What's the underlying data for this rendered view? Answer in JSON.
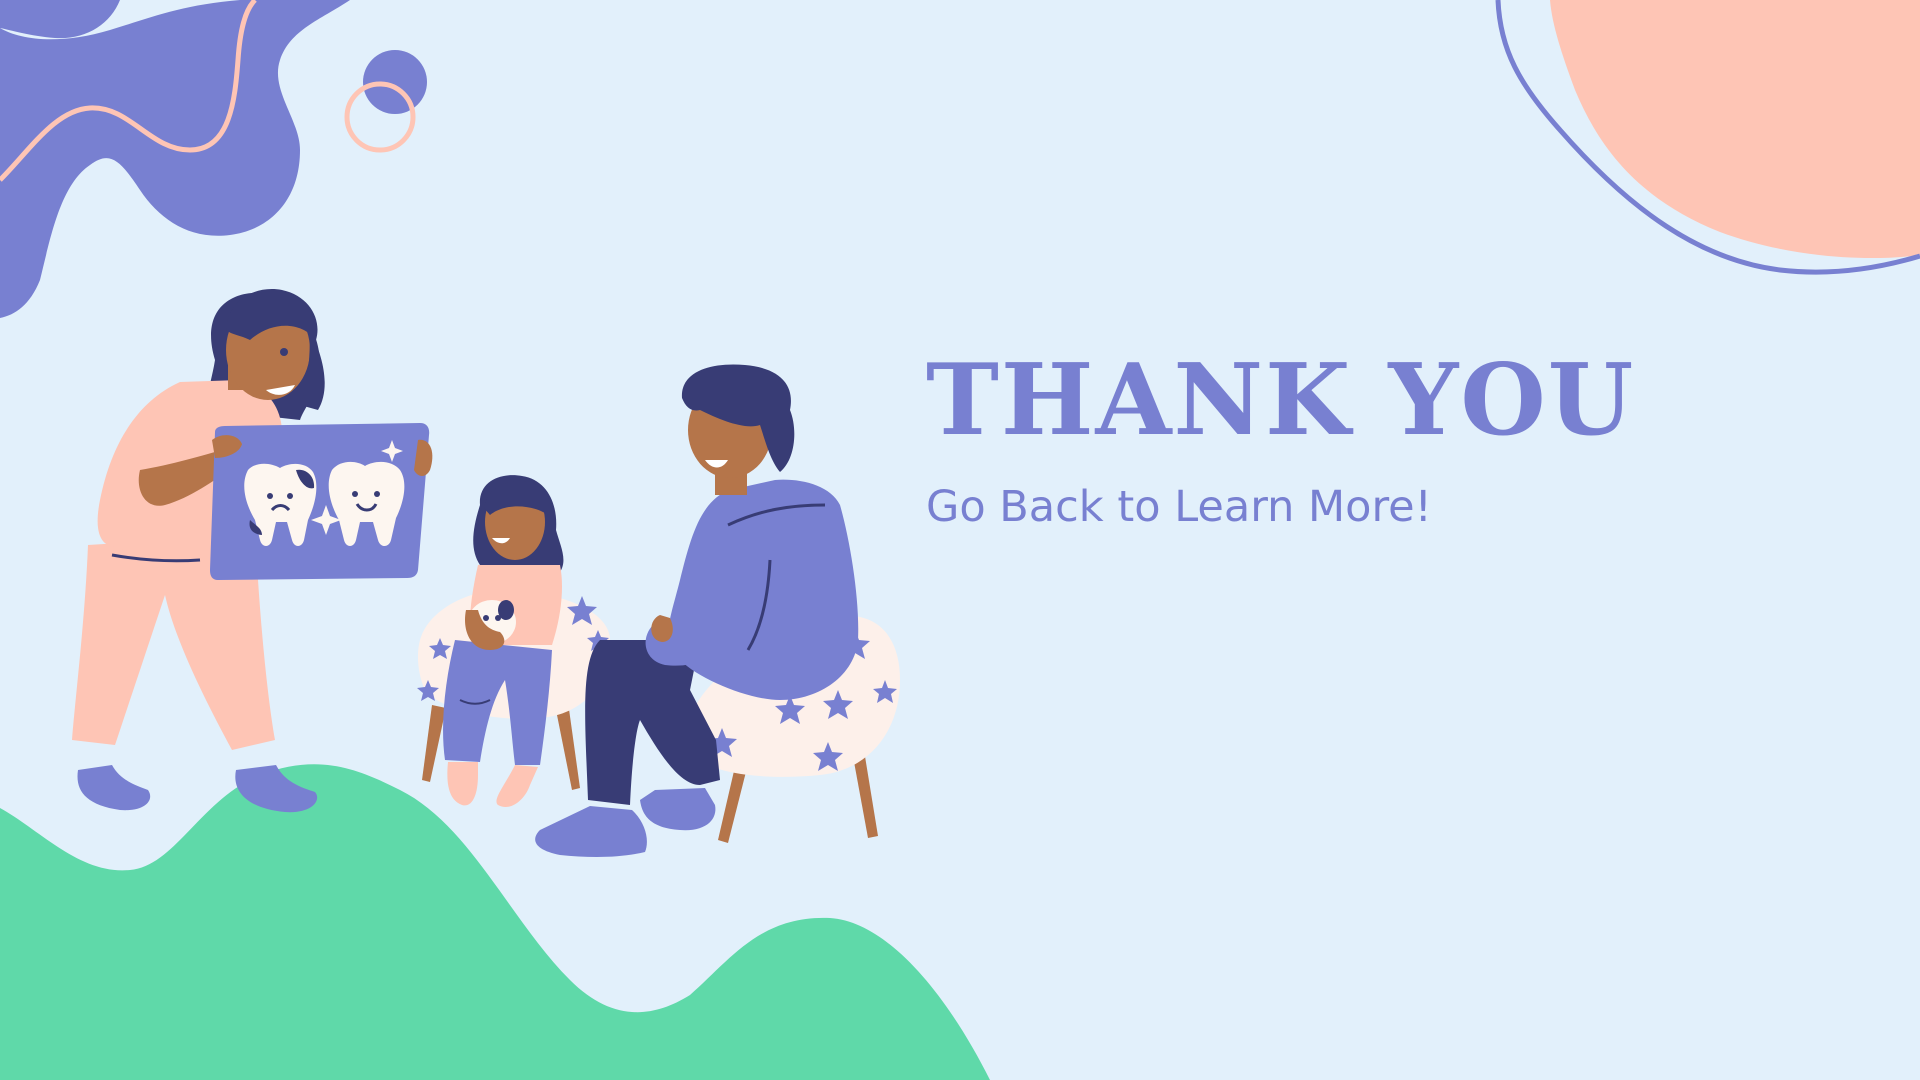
{
  "slide": {
    "title": "THANK YOU",
    "subtitle": "Go Back to Learn More!"
  },
  "colors": {
    "background": "#e2f0fb",
    "accent_purple": "#7880d1",
    "peach": "#fec5b5",
    "green": "#5fd9a9",
    "navy": "#383c75",
    "skin": "#b5754a"
  },
  "icons": [
    "tooth-sad-icon",
    "tooth-happy-icon",
    "sparkle-icon",
    "star-icon"
  ]
}
